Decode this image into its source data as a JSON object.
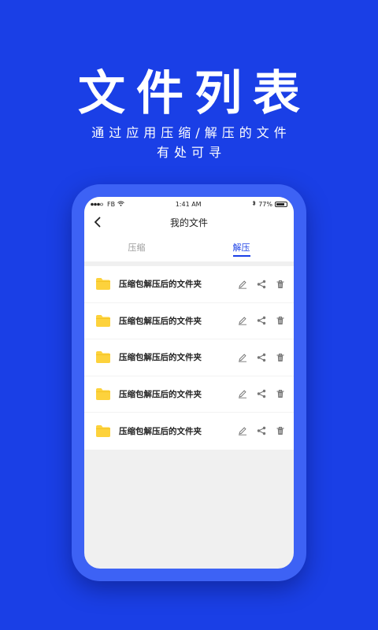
{
  "hero": {
    "title": "文件列表",
    "subtitle_line1": "通过应用压缩/解压的文件",
    "subtitle_line2": "有处可寻"
  },
  "status_bar": {
    "carrier": "FB",
    "time": "1:41 AM",
    "battery_percent": "77%"
  },
  "nav": {
    "title": "我的文件"
  },
  "tabs": [
    {
      "label": "压缩",
      "active": false
    },
    {
      "label": "解压",
      "active": true
    }
  ],
  "files": [
    {
      "name": "压缩包解压后的文件夹"
    },
    {
      "name": "压缩包解压后的文件夹"
    },
    {
      "name": "压缩包解压后的文件夹"
    },
    {
      "name": "压缩包解压后的文件夹"
    },
    {
      "name": "压缩包解压后的文件夹"
    }
  ],
  "icons": {
    "back": "chevron-left-icon",
    "folder": "folder-icon",
    "rename": "pencil-icon",
    "share": "share-icon",
    "delete": "trash-icon"
  },
  "colors": {
    "background": "#1a3fe6",
    "phone_frame": "#3d62f5",
    "accent": "#1a3fe6",
    "folder": "#fdd23c"
  }
}
